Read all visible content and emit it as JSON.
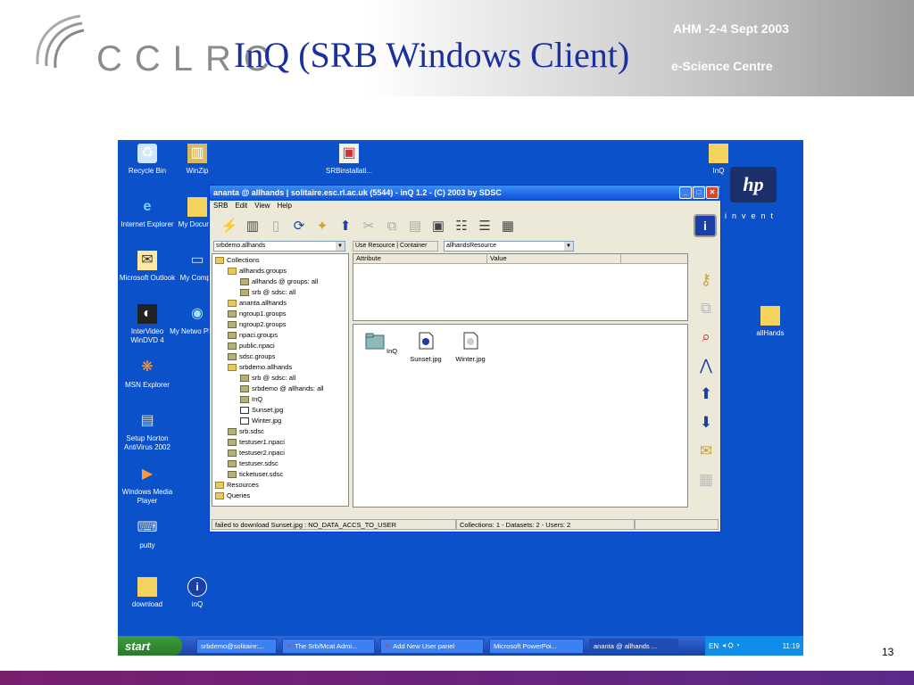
{
  "slide": {
    "logo_text": "CCLRC",
    "title": "InQ (SRB Windows Client)",
    "conference": "AHM -2-4 Sept 2003",
    "centre": "e-Science Centre",
    "page_number": "13"
  },
  "desktop": {
    "icons": [
      {
        "label": "Recycle Bin",
        "icon": "recycle-bin-icon"
      },
      {
        "label": "WinZip",
        "icon": "winzip-icon"
      },
      {
        "label": "SRBinstallati...",
        "icon": "installer-icon"
      },
      {
        "label": "InQ",
        "icon": "folder-icon"
      },
      {
        "label": "Internet Explorer",
        "icon": "ie-icon"
      },
      {
        "label": "My Docume",
        "icon": "my-documents-icon"
      },
      {
        "label": "Microsoft Outlook",
        "icon": "outlook-icon"
      },
      {
        "label": "My Compu",
        "icon": "my-computer-icon"
      },
      {
        "label": "InterVideo WinDVD 4",
        "icon": "dvd-icon"
      },
      {
        "label": "My Netwo Places",
        "icon": "network-icon"
      },
      {
        "label": "MSN Explorer",
        "icon": "msn-icon"
      },
      {
        "label": "Setup Norton AntiVirus 2002",
        "icon": "norton-icon"
      },
      {
        "label": "Windows Media Player",
        "icon": "media-player-icon"
      },
      {
        "label": "putty",
        "icon": "putty-icon"
      },
      {
        "label": "download",
        "icon": "folder-icon"
      },
      {
        "label": "inQ",
        "icon": "info-icon"
      },
      {
        "label": "allHands",
        "icon": "folder-icon"
      }
    ],
    "hp_logo": "hp",
    "hp_invent": "invent"
  },
  "window": {
    "title": "ananta @ allhands | solitaire.esc.rl.ac.uk (5544) - inQ 1.2 - (C) 2003 by SDSC",
    "menu": [
      "SRB",
      "Edit",
      "View",
      "Help"
    ],
    "collection_select": "srbdemo.allhands",
    "resource_label": "Use Resource | Container",
    "resource_select": "allhandsResource",
    "attr_headers": [
      "Attribute",
      "Value"
    ],
    "tree": [
      {
        "label": "Collections",
        "indent": 0,
        "type": "root"
      },
      {
        "label": "allhands.groups",
        "indent": 1,
        "type": "folder"
      },
      {
        "label": "allhands @ groups:  all",
        "indent": 2,
        "type": "db"
      },
      {
        "label": "srb @ sdsc:  all",
        "indent": 2,
        "type": "db"
      },
      {
        "label": "ananta.allhands",
        "indent": 1,
        "type": "folder"
      },
      {
        "label": "ngroup1.groups",
        "indent": 1,
        "type": "db"
      },
      {
        "label": "ngroup2.groups",
        "indent": 1,
        "type": "db"
      },
      {
        "label": "npaci.groups",
        "indent": 1,
        "type": "db"
      },
      {
        "label": "public.npaci",
        "indent": 1,
        "type": "db"
      },
      {
        "label": "sdsc.groups",
        "indent": 1,
        "type": "db"
      },
      {
        "label": "srbdemo.allhands",
        "indent": 1,
        "type": "folder"
      },
      {
        "label": "srb @ sdsc:  all",
        "indent": 2,
        "type": "db"
      },
      {
        "label": "srbdemo @ allhands:  all",
        "indent": 2,
        "type": "db"
      },
      {
        "label": "InQ",
        "indent": 2,
        "type": "db"
      },
      {
        "label": "Sunset.jpg",
        "indent": 2,
        "type": "doc"
      },
      {
        "label": "Winter.jpg",
        "indent": 2,
        "type": "doc"
      },
      {
        "label": "srb.sdsc",
        "indent": 1,
        "type": "db"
      },
      {
        "label": "testuser1.npaci",
        "indent": 1,
        "type": "db"
      },
      {
        "label": "testuser2.npaci",
        "indent": 1,
        "type": "db"
      },
      {
        "label": "testuser.sdsc",
        "indent": 1,
        "type": "db"
      },
      {
        "label": "ticketuser.sdsc",
        "indent": 1,
        "type": "db"
      },
      {
        "label": "Resources",
        "indent": 0,
        "type": "root"
      },
      {
        "label": "Queries",
        "indent": 0,
        "type": "root"
      }
    ],
    "files": [
      "InQ",
      "Sunset.jpg",
      "Winter.jpg"
    ],
    "status_message": "failed to download Sunset.jpg : NO_DATA_ACCS_TO_USER",
    "status_counts": "Collections: 1 - Datasets: 2 - Users: 2"
  },
  "taskbar": {
    "start": "start",
    "tasks": [
      "srbdemo@solitaire:...",
      "The Srb/Mcat Admi...",
      "Add New User panel",
      "Microsoft PowerPoi...",
      "ananta @ allhands ..."
    ],
    "lang": "EN",
    "clock": "11:19"
  }
}
